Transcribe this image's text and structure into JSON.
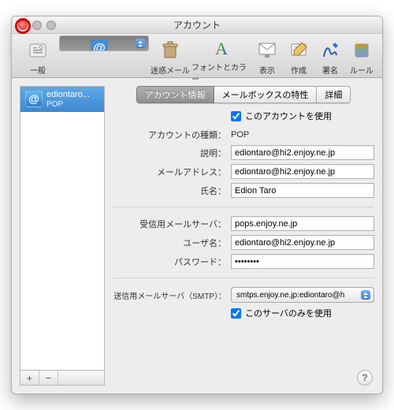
{
  "window": {
    "title": "アカウント"
  },
  "toolbar": {
    "items": [
      {
        "label": "一般"
      },
      {
        "label": "アカウント"
      },
      {
        "label": "迷惑メール"
      },
      {
        "label": "フォントとカラー"
      },
      {
        "label": "表示"
      },
      {
        "label": "作成"
      },
      {
        "label": "署名"
      },
      {
        "label": "ルール"
      }
    ]
  },
  "sidebar": {
    "account": {
      "name": "ediontaro...",
      "type": "POP"
    },
    "add": "+",
    "remove": "−"
  },
  "tabs": {
    "info": "アカウント情報",
    "mailbox": "メールボックスの特性",
    "detail": "詳細"
  },
  "form": {
    "enable_label": "このアカウントを使用",
    "type_label": "アカウントの種類：",
    "type_value": "POP",
    "desc_label": "説明：",
    "desc_value": "ediontaro@hi2.enjoy.ne.jp",
    "email_label": "メールアドレス：",
    "email_value": "ediontaro@hi2.enjoy.ne.jp",
    "name_label": "氏名：",
    "name_value": "Edion Taro",
    "incoming_label": "受信用メールサーバ：",
    "incoming_value": "pops.enjoy.ne.jp",
    "user_label": "ユーザ名：",
    "user_value": "ediontaro@hi2.enjoy.ne.jp",
    "pass_label": "パスワード：",
    "pass_value": "••••••••",
    "smtp_label": "送信用メールサーバ（SMTP）：",
    "smtp_value": "smtps.enjoy.ne.jp:ediontaro@h",
    "onlyserver_label": "このサーバのみを使用"
  },
  "help": "?"
}
